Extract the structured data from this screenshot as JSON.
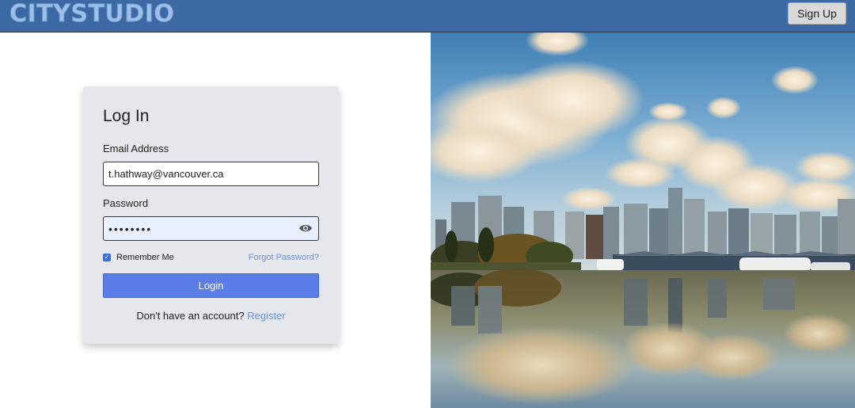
{
  "header": {
    "logo_text": "CITYSTUDIO",
    "signup_label": "Sign Up"
  },
  "login": {
    "title": "Log In",
    "email_label": "Email Address",
    "email_value": "t.hathway@vancouver.ca",
    "password_label": "Password",
    "password_value": "••••••••",
    "remember_label": "Remember Me",
    "remember_checked": true,
    "forgot_label": "Forgot Password?",
    "login_label": "Login",
    "no_account_text": "Don't have an account?",
    "register_label": "Register"
  },
  "icons": {
    "password_toggle": "eye-icon",
    "checkbox": "check-icon"
  },
  "colors": {
    "header_bg": "#3c68a3",
    "logo": "#9cc0e8",
    "login_button": "#5b7ee6",
    "link": "#6e93d6",
    "card_bg": "#e5e7ec"
  }
}
